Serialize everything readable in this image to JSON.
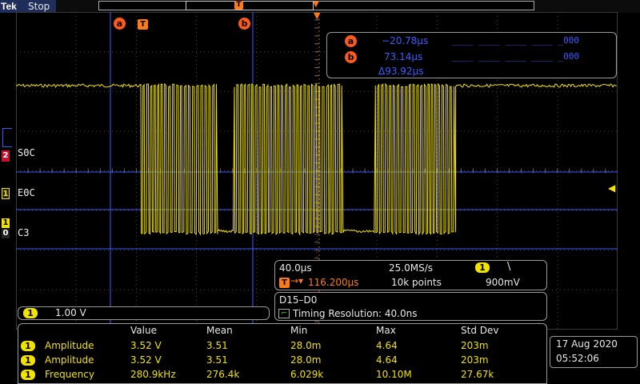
{
  "header": {
    "brand": "Tek",
    "run_state": "Stop",
    "trigger_marker": "T",
    "cursor_b_marker": "b"
  },
  "cursors": {
    "a_label": "a",
    "b_label": "b",
    "trigger_label": "T",
    "a_value": "−20.78µs",
    "b_value": "73.14µs",
    "delta": "Δ93.92µs",
    "a_digital": "____ ____ ____ ____ _000",
    "b_digital": "____ ____ ____ ____ _000"
  },
  "channels": {
    "ch2_num": "2",
    "ch2_label": "S0C",
    "ch1_num": "1",
    "ch1_label": "E0C",
    "ch3_top": "1",
    "ch3_bottom": "0",
    "ch3_label": "C3"
  },
  "horizontal": {
    "time_div": "40.0µs",
    "sample_rate": "25.0MS/s",
    "trig_channel": "1",
    "trig_slope": "\\",
    "trig_pos_prefix": "T",
    "trig_pos_value": "116.200µs",
    "record_length": "10k points",
    "trig_level": "900mV"
  },
  "vertical": {
    "channel": "1",
    "scale": "1.00 V"
  },
  "bus": {
    "name": "D15–D0",
    "timing_resolution": "Timing Resolution: 40.0ns"
  },
  "measurements": {
    "headers": [
      "Value",
      "Mean",
      "Min",
      "Max",
      "Std Dev"
    ],
    "rows": [
      {
        "ch": "1",
        "name": "Amplitude",
        "value": "3.52 V",
        "mean": "3.51",
        "min": "28.0m",
        "max": "4.64",
        "std": "203m"
      },
      {
        "ch": "1",
        "name": "Amplitude",
        "value": "3.52 V",
        "mean": "3.51",
        "min": "28.0m",
        "max": "4.64",
        "std": "203m"
      },
      {
        "ch": "1",
        "name": "Frequency",
        "value": "280.9kHz",
        "mean": "276.4k",
        "min": "6.029k",
        "max": "10.10M",
        "std": "27.67k"
      }
    ]
  },
  "datetime": {
    "date": "17 Aug  2020",
    "time": "05:52:06"
  },
  "colors": {
    "ch1": "#f2e200",
    "cursor": "#3a5cff",
    "trigger": "#ff7a1a"
  }
}
